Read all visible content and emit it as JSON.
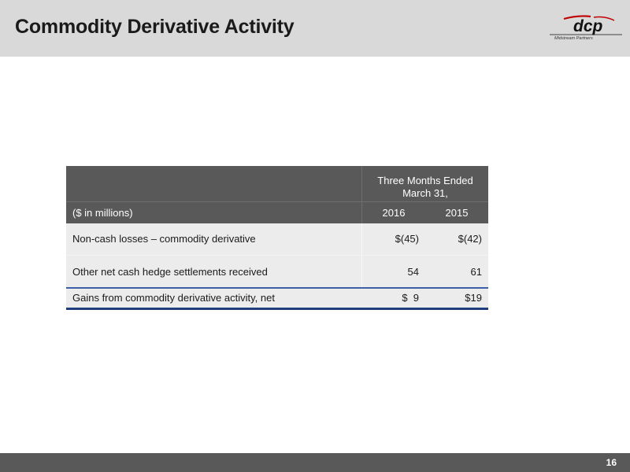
{
  "slide": {
    "title": "Commodity Derivative Activity",
    "page_number": "16"
  },
  "logo": {
    "icon": "dcp-midstream-partners-logo",
    "brand_text": "dcp",
    "sub_text": "Midstream Partners"
  },
  "table": {
    "period_header": [
      "Three Months Ended",
      "March 31,"
    ],
    "unit_label": "($ in millions)",
    "columns": [
      "2016",
      "2015"
    ],
    "rows": [
      {
        "label": "Non-cash losses – commodity derivative",
        "values": [
          "$(45)",
          "$(42)"
        ]
      },
      {
        "label": "Other net cash hedge settlements received",
        "values": [
          "54",
          "61"
        ]
      },
      {
        "label": "Gains from commodity derivative activity, net",
        "values": [
          "$  9",
          "$19"
        ]
      }
    ]
  },
  "colors": {
    "header_band": "#d9d9d9",
    "table_header": "#595959",
    "table_body": "#ececec",
    "total_rule": "#1f3d7a",
    "logo_red": "#c00000",
    "footer_band": "#595959"
  }
}
